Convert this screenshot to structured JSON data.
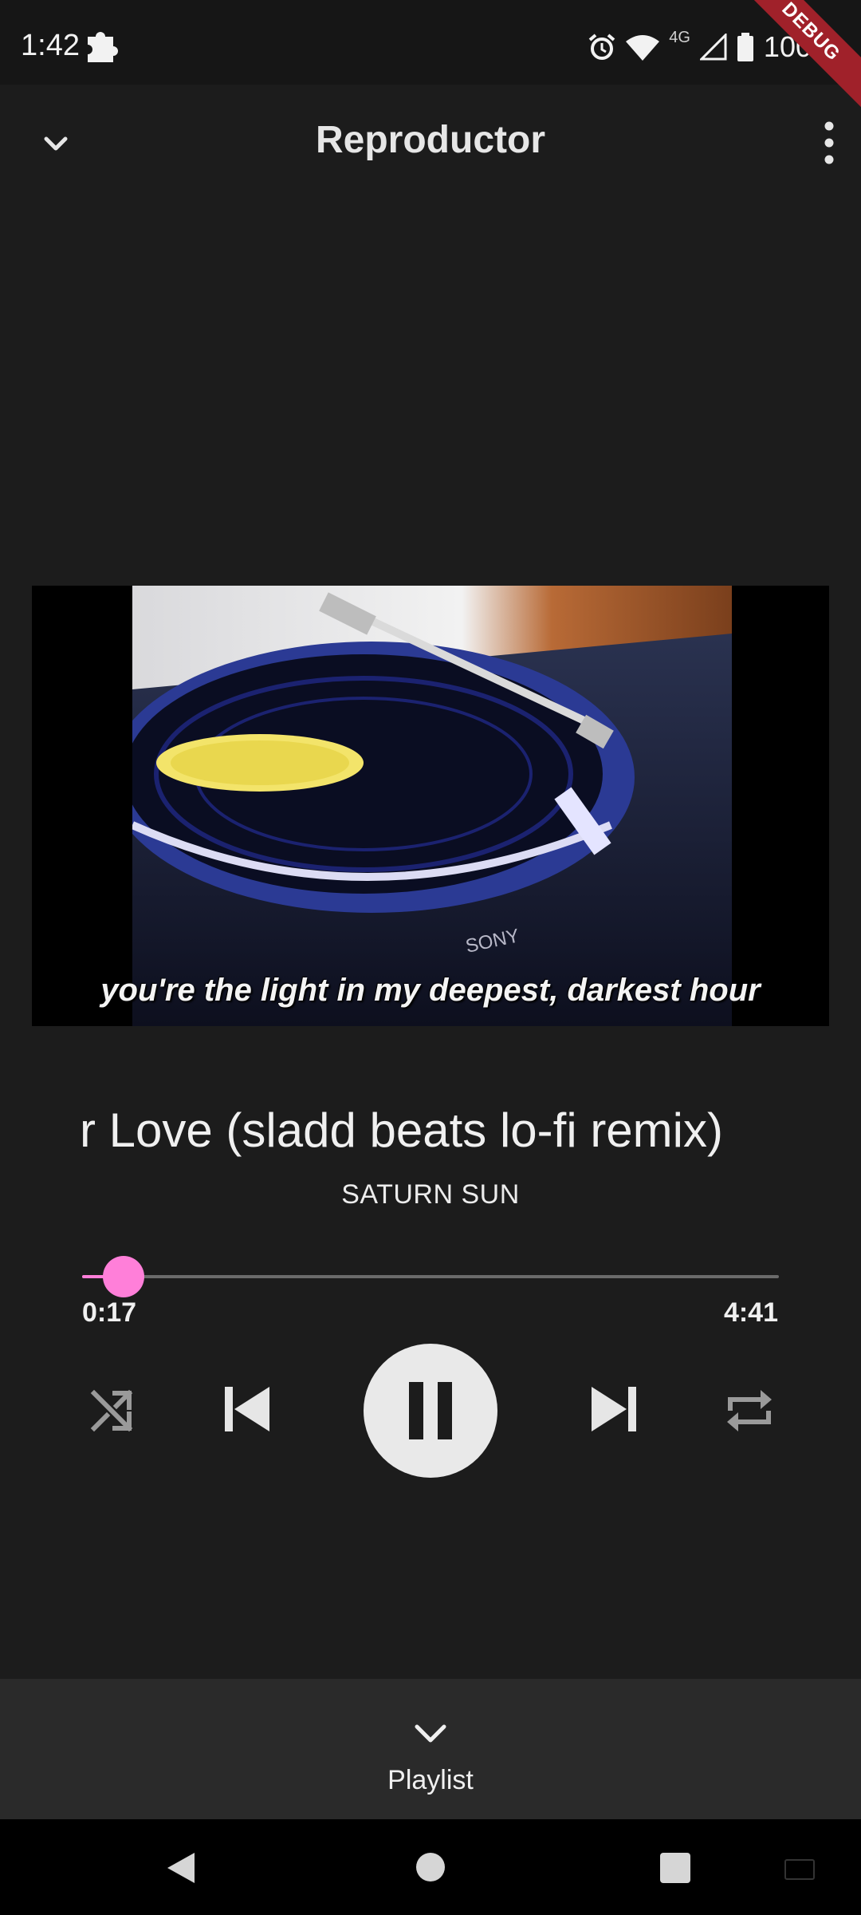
{
  "status_bar": {
    "time": "1:42",
    "network": "4G",
    "battery": "100 %"
  },
  "debug_banner": "DEBUG",
  "app_bar": {
    "title": "Reproductor",
    "collapse_icon": "chevron-down-icon",
    "menu_icon": "more-vertical-icon"
  },
  "artwork": {
    "caption": "you're the light in my deepest, darkest hour"
  },
  "track": {
    "title": "r Love (sladd beats lo-fi remix)",
    "artist": "SATURN SUN"
  },
  "progress": {
    "elapsed": "0:17",
    "total": "4:41",
    "fraction": 0.06,
    "accent_color": "#ff7fd9"
  },
  "controls": {
    "shuffle_icon": "shuffle-icon",
    "previous_icon": "skip-previous-icon",
    "play_pause_icon": "pause-icon",
    "next_icon": "skip-next-icon",
    "repeat_icon": "repeat-icon"
  },
  "playlist_panel": {
    "label": "Playlist",
    "icon": "chevron-down-icon"
  }
}
